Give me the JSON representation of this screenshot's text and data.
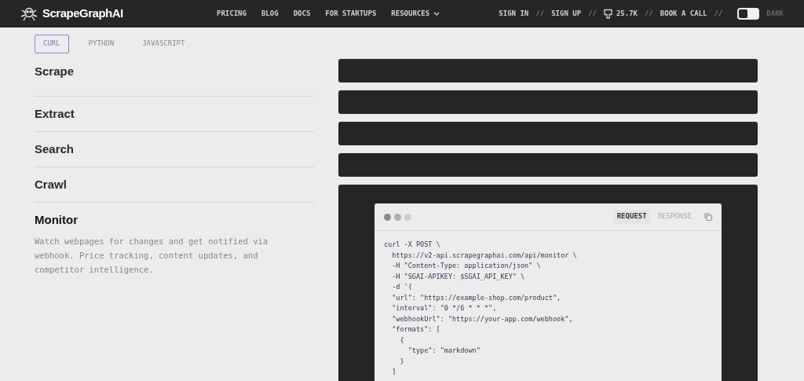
{
  "nav": {
    "brand": "ScrapeGraphAI",
    "links": [
      {
        "label": "PRICING",
        "dropdown": false
      },
      {
        "label": "BLOG",
        "dropdown": false
      },
      {
        "label": "DOCS",
        "dropdown": false
      },
      {
        "label": "FOR STARTUPS",
        "dropdown": false
      },
      {
        "label": "RESOURCES",
        "dropdown": true
      }
    ],
    "right": [
      {
        "label": "SIGN IN",
        "kind": "link"
      },
      {
        "label": "//",
        "kind": "sep"
      },
      {
        "label": "SIGN UP",
        "kind": "link"
      },
      {
        "label": "//",
        "kind": "sep"
      },
      {
        "label": "25.7K",
        "kind": "github"
      },
      {
        "label": "//",
        "kind": "sep"
      },
      {
        "label": "BOOK A CALL",
        "kind": "link"
      },
      {
        "label": "//",
        "kind": "sep"
      }
    ],
    "theme_toggle": {
      "label": "DARK",
      "on": false
    }
  },
  "lang_tabs": [
    {
      "label": "CURL",
      "selected": true
    },
    {
      "label": "PYTHON",
      "selected": false
    },
    {
      "label": "JAVASCRIPT",
      "selected": false
    }
  ],
  "features": [
    {
      "title": "Scrape",
      "expanded": false
    },
    {
      "title": "Extract",
      "expanded": false
    },
    {
      "title": "Search",
      "expanded": false
    },
    {
      "title": "Crawl",
      "expanded": false
    },
    {
      "title": "Monitor",
      "expanded": true,
      "description": "Watch webpages for changes and get notified via webhook. Price tracking, content updates, and competitor intelligence."
    }
  ],
  "code_card": {
    "tabs": [
      {
        "label": "REQUEST",
        "selected": true
      },
      {
        "label": "RESPONSE",
        "selected": false
      }
    ],
    "lines": [
      "curl -X POST \\",
      "  https://v2-api.scrapegraphai.com/api/monitor \\",
      "  -H \"Content-Type: application/json\" \\",
      "  -H \"SGAI-APIKEY: $SGAI_API_KEY\" \\",
      "  -d '{",
      "  \"url\": \"https://example-shop.com/product\",",
      "  \"interval\": \"0 */6 * * *\",",
      "  \"webhookUrl\": \"https://your-app.com/webhook\",",
      "  \"formats\": [",
      "    {",
      "      \"type\": \"markdown\"",
      "    }",
      "  ]"
    ]
  }
}
